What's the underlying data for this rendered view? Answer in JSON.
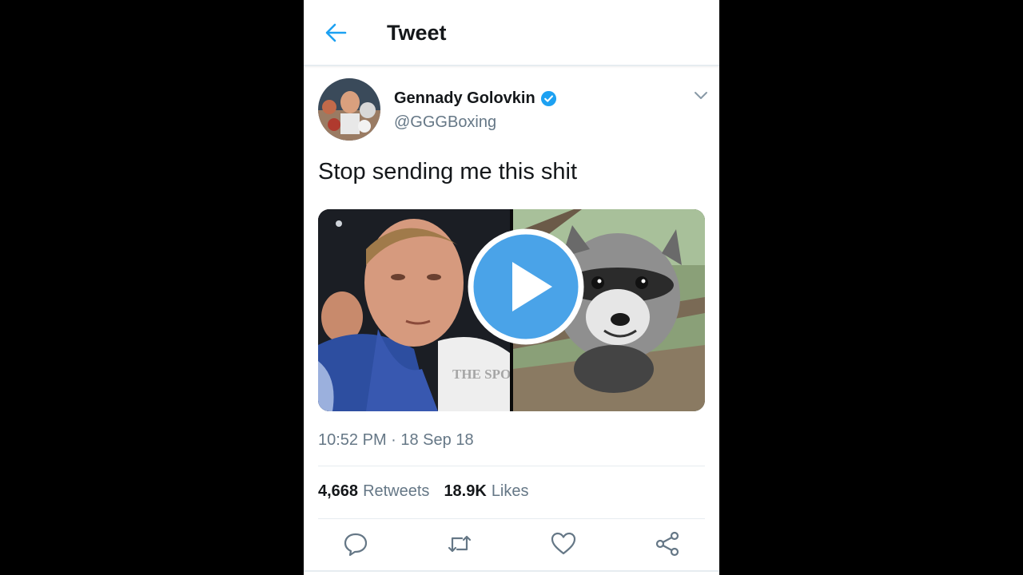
{
  "header": {
    "title": "Tweet"
  },
  "user": {
    "name": "Gennady Golovkin",
    "handle": "@GGGBoxing",
    "verified": true
  },
  "tweet": {
    "text": "Stop sending me this shit",
    "timestamp": "10:52 PM · 18 Sep 18",
    "media_watermark": "THE SPORT RAG"
  },
  "stats": {
    "retweets_count": "4,668",
    "retweets_label": "Retweets",
    "likes_count": "18.9K",
    "likes_label": "Likes"
  },
  "colors": {
    "accent": "#1da1f2",
    "play": "#4aa3e8",
    "text": "#14171a",
    "muted": "#657786"
  },
  "icons": [
    "back-arrow-icon",
    "verified-icon",
    "chevron-down-icon",
    "play-icon",
    "reply-icon",
    "retweet-icon",
    "like-icon",
    "share-icon"
  ]
}
